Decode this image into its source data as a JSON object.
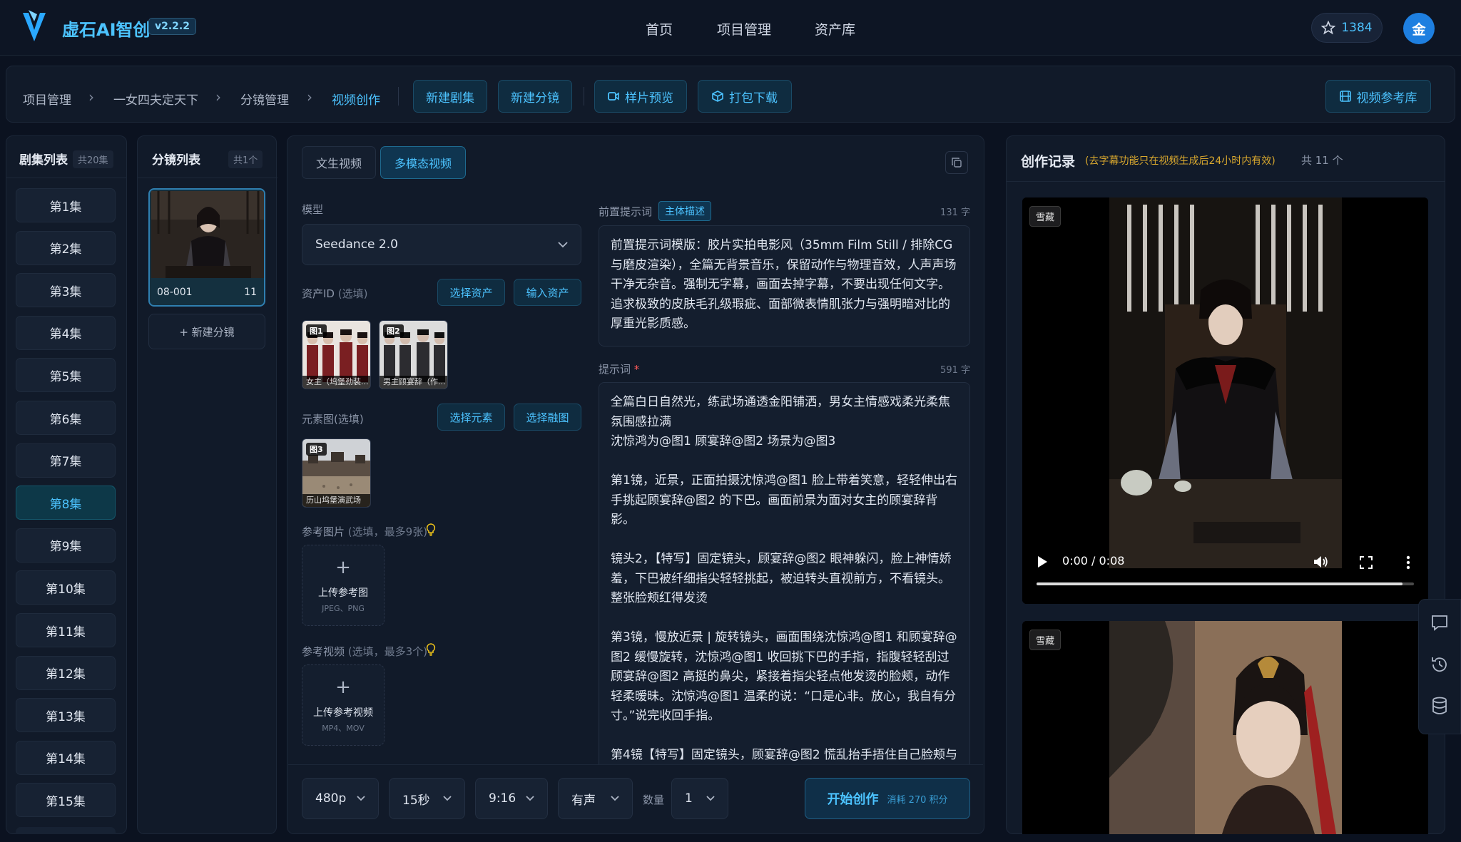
{
  "header": {
    "brand": "虚石AI智创",
    "version": "v2.2.2",
    "nav": [
      "首页",
      "项目管理",
      "资产库"
    ],
    "points": "1384",
    "avatar_char": "金"
  },
  "breadcrumb": {
    "items": [
      "项目管理",
      "一女四夫定天下",
      "分镜管理",
      "视频创作"
    ],
    "buttons": {
      "new_series": "新建剧集",
      "new_shot": "新建分镜",
      "preview": "样片预览",
      "download": "打包下载",
      "video_ref": "视频参考库"
    }
  },
  "episodes": {
    "title": "剧集列表",
    "count": "共20集",
    "items": [
      "第1集",
      "第2集",
      "第3集",
      "第4集",
      "第5集",
      "第6集",
      "第7集",
      "第8集",
      "第9集",
      "第10集",
      "第11集",
      "第12集",
      "第13集",
      "第14集",
      "第15集"
    ],
    "active_index": 7
  },
  "shots": {
    "title": "分镜列表",
    "count": "共1个",
    "card": {
      "id": "08-001",
      "num": "11"
    },
    "new_label": "+ 新建分镜"
  },
  "editor": {
    "tabs": [
      "文生视频",
      "多模态视频"
    ],
    "model_label": "模型",
    "model_value": "Seedance 2.0",
    "asset_label": "资产ID",
    "asset_opt": "(选填)",
    "select_asset": "选择资产",
    "input_asset": "输入资产",
    "asset_thumbs": [
      {
        "tag": "图1",
        "caption": "女主（坞堡劲装..."
      },
      {
        "tag": "图2",
        "caption": "男主顾宴辞（作..."
      }
    ],
    "element_label": "元素图(选填)",
    "select_element": "选择元素",
    "select_fusion": "选择融图",
    "element_thumb": {
      "tag": "图3",
      "caption": "历山坞堡演武场"
    },
    "ref_image_label": "参考图片",
    "ref_image_opt": "(选填，最多9张)",
    "upload_image": {
      "title": "上传参考图",
      "sub": "JPEG、PNG"
    },
    "ref_video_label": "参考视频",
    "ref_video_opt": "(选填，最多3个)",
    "upload_video": {
      "title": "上传参考视频",
      "sub": "MP4、MOV"
    },
    "pre_prompt_label": "前置提示词",
    "pre_prompt_tag": "主体描述",
    "pre_prompt_count": "131 字",
    "pre_prompt_text": "前置提示词模版：胶片实拍电影风（35mm Film Still / 排除CG与磨皮渲染），全篇无背景音乐，保留动作与物理音效，人声声场干净无杂音。强制无字幕，画面去掉字幕，不要出现任何文字。追求极致的皮肤毛孔级瑕疵、面部微表情肌张力与强明暗对比的厚重光影质感。",
    "prompt_label": "提示词",
    "prompt_required": "*",
    "prompt_count": "591 字",
    "prompt_text": "全篇白日自然光，练武场通透金阳铺洒，男女主情感戏柔光柔焦氛围感拉满\n沈惊鸿为@图1 顾宴辞@图2 场景为@图3\n\n第1镜，近景，正面拍摄沈惊鸿@图1 脸上带着笑意，轻轻伸出右手挑起顾宴辞@图2 的下巴。画面前景为面对女主的顾宴辞背影。\n\n镜头2，【特写】固定镜头，顾宴辞@图2 眼神躲闪，脸上神情娇羞，下巴被纤细指尖轻轻挑起，被迫转头直视前方，不看镜头。整张脸颊红得发烫\n\n第3镜，慢放近景 | 旋转镜头，画面围绕沈惊鸿@图1 和顾宴辞@图2 缓慢旋转，沈惊鸿@图1 收回挑下巴的手指，指腹轻轻刮过顾宴辞@图2 高挺的鼻尖，紧接着指尖轻点他发烫的脸颊，动作轻柔暧昧。沈惊鸿@图1 温柔的说：“口是心非。放心，我自有分寸。”说完收回手指。\n\n第4镜【特写】固定镜头，顾宴辞@图2 慌乱抬手捂住自己脸颊与",
    "settings": {
      "resolution": "480p",
      "duration": "15秒",
      "ratio": "9:16",
      "audio": "有声",
      "qty_label": "数量",
      "qty": "1"
    },
    "start_label": "开始创作",
    "cost_label": "消耗 270 积分"
  },
  "records": {
    "title": "创作记录",
    "note": "(去字幕功能只在视频生成后24小时内有效)",
    "count": "共 11 个",
    "tag": "雪藏",
    "time": "0:00 / 0:08",
    "progress_fraction": 0.97
  }
}
